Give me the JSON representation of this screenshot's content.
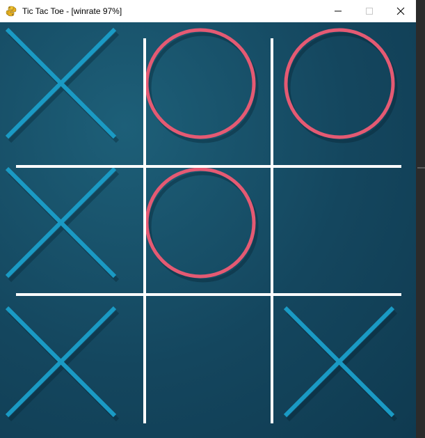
{
  "window": {
    "title": "Tic Tac Toe - [winrate 97%]",
    "app_icon": "python-snake-icon"
  },
  "controls": {
    "minimize": "minimize-icon",
    "maximize": "maximize-icon",
    "close": "close-icon"
  },
  "colors": {
    "x_mark": "#1a9ac4",
    "o_mark": "#e55a73",
    "grid": "#ffffff",
    "board_bg": "#14465e"
  },
  "board": {
    "cells": [
      [
        "X",
        "O",
        "O"
      ],
      [
        "X",
        "O",
        ""
      ],
      [
        "X",
        "",
        "X"
      ]
    ]
  }
}
